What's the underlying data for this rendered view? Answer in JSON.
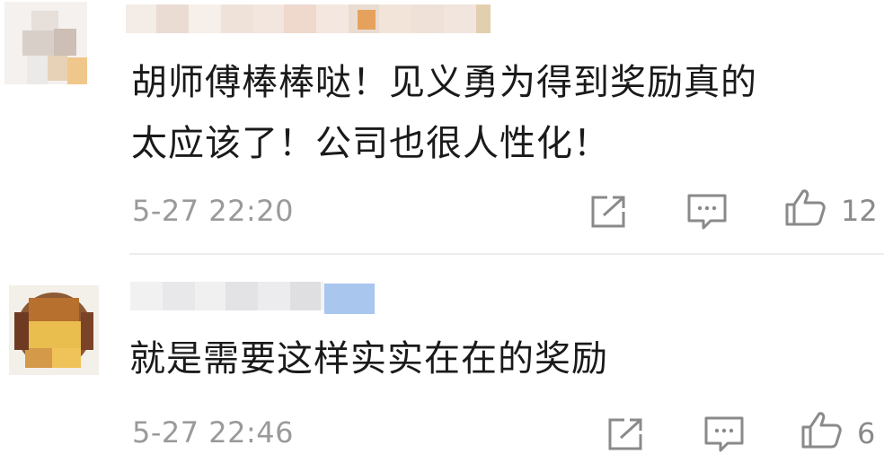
{
  "comments": [
    {
      "text_line1": "胡师傅棒棒哒！见义勇为得到奖励真的",
      "text_line2": "太应该了！公司也很人性化！",
      "timestamp": "5-27 22:20",
      "like_count": "12"
    },
    {
      "text_line1": "就是需要这样实实在在的奖励",
      "timestamp": "5-27 22:46",
      "like_count": "6"
    }
  ],
  "icons": {
    "share": "share-icon",
    "reply": "comment-icon",
    "like": "thumbs-up-icon"
  },
  "colors": {
    "text": "#1a1a1a",
    "meta": "#9a9a9a",
    "icon": "#8a8a8a",
    "divider": "#ededed"
  }
}
